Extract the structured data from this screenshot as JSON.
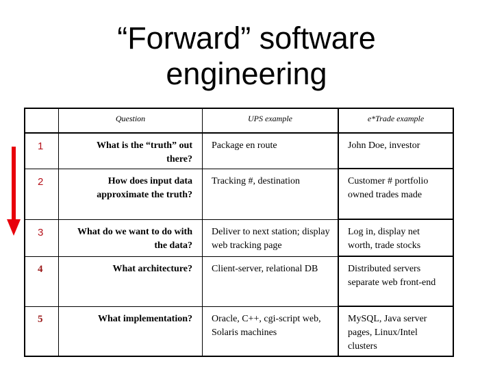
{
  "title": {
    "line1": "“Forward” software",
    "line2": "engineering"
  },
  "arrow": {
    "icon": "down-arrow-icon",
    "color": "#e8000b"
  },
  "table": {
    "headers": [
      "",
      "Question",
      "UPS example",
      "e*Trade example"
    ],
    "rows": [
      {
        "num": "1",
        "question": "What is the “truth” out there?",
        "ups": "Package en route",
        "etrade": "John Doe, investor"
      },
      {
        "num": "2",
        "question": "How does input data approximate the truth?",
        "ups": "Tracking #, destination",
        "etrade": "Customer # portfolio owned trades made"
      },
      {
        "num": "3",
        "question": "What do we want to do with the data?",
        "ups": "Deliver to next station; display web tracking page",
        "etrade": "Log in, display net worth, trade stocks"
      },
      {
        "num": "4",
        "question": "What architecture?",
        "ups": "Client-server, relational DB",
        "etrade": "Distributed servers separate web front-end"
      },
      {
        "num": "5",
        "question": "What implementation?",
        "ups": "Oracle, C++, cgi-script web, Solaris machines",
        "etrade": "MySQL, Java server pages, Linux/Intel clusters"
      }
    ]
  },
  "colors": {
    "row_number": "#b5121b",
    "border": "#000000"
  }
}
